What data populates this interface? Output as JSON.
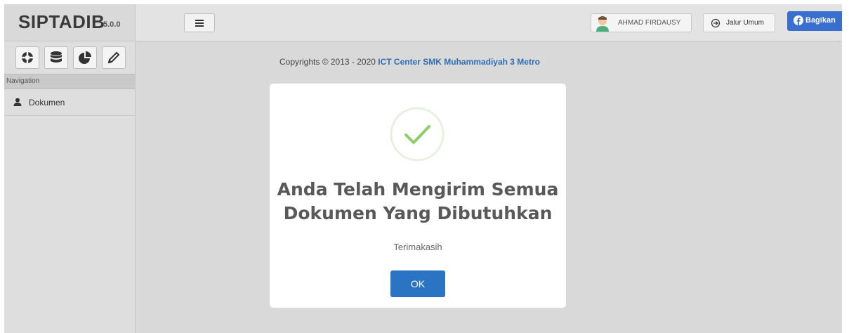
{
  "app": {
    "brand": "SIPTADIB",
    "version": "5.0.0"
  },
  "header": {
    "menu_toggle_icon": "hamburger-icon",
    "user_name": "AHMAD FIRDAUSY",
    "jalur_label": "Jalur Umum",
    "share_label": "Bagikan"
  },
  "sidebar": {
    "shortcuts": [
      {
        "icon": "lifebuoy-icon"
      },
      {
        "icon": "database-icon"
      },
      {
        "icon": "pie-chart-icon"
      },
      {
        "icon": "pencil-icon"
      }
    ],
    "nav_header": "Navigation",
    "items": [
      {
        "label": "Dokumen",
        "icon": "user-icon"
      }
    ]
  },
  "main": {
    "copyright_prefix": "Copyrights © 2013 - 2020",
    "copyright_org": "ICT Center SMK Muhammadiyah 3 Metro"
  },
  "modal": {
    "icon": "success-check-icon",
    "title_line1": "Anda Telah Mengirim Semua",
    "title_line2": "Dokumen Yang Dibutuhkan",
    "text": "Terimakasih",
    "ok_label": "OK"
  },
  "colors": {
    "primary": "#2b74c3",
    "facebook": "#3a6fcf",
    "success": "#8fcc6a",
    "link": "#2f6db3"
  }
}
